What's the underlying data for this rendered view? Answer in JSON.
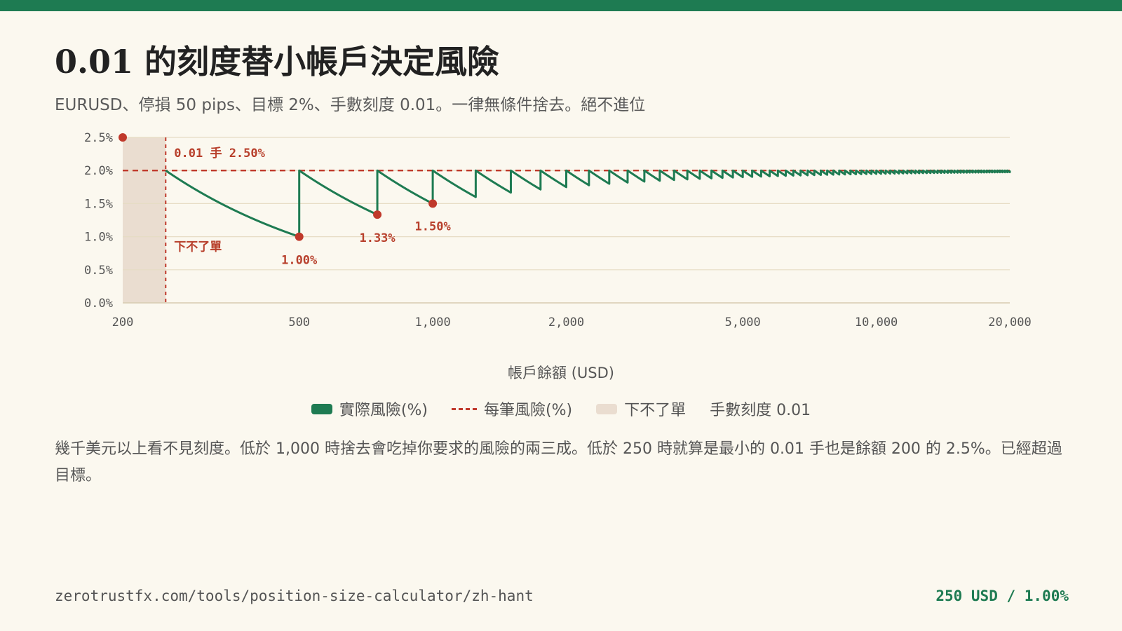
{
  "header": {
    "title": "0.01 的刻度替小帳戶決定風險",
    "subtitle": "EURUSD、停損 50 pips、目標 2%、手數刻度 0.01。一律無條件捨去。絕不進位"
  },
  "chart_data": {
    "type": "line",
    "xlabel": "帳戶餘額 (USD)",
    "x_scale": "log",
    "xlim": [
      200,
      20000
    ],
    "ylim": [
      0,
      2.5
    ],
    "x_ticks": [
      200,
      500,
      1000,
      2000,
      5000,
      10000,
      20000
    ],
    "x_tick_labels": [
      "200",
      "500",
      "1,000",
      "2,000",
      "5,000",
      "10,000",
      "20,000"
    ],
    "y_ticks": [
      0,
      0.5,
      1.0,
      1.5,
      2.0,
      2.5
    ],
    "y_tick_labels": [
      "0.0%",
      "0.5%",
      "1.0%",
      "1.5%",
      "2.0%",
      "2.5%"
    ],
    "grid": true,
    "legend_position": "bottom-center",
    "series": [
      {
        "name": "實際風險(%)",
        "color": "#1e7b52",
        "rule": "floor(balance * 2% / 500 USD per lot, step 0.01) * 500 / balance * 100",
        "min_balance": 250,
        "max_balance": 20000
      },
      {
        "name": "每筆風險(%)",
        "color": "#c0392b",
        "style": "dashed",
        "value": 2.0
      }
    ],
    "shaded_region": {
      "name": "下不了單",
      "from": 200,
      "to": 250,
      "color": "#eaddd0"
    },
    "vertical_marker": {
      "x": 250,
      "label_top": "0.01 手 2.50%",
      "label_bottom": "下不了單"
    },
    "points": [
      {
        "x": 200,
        "y": 2.5,
        "label": ""
      },
      {
        "x": 500,
        "y": 1.0,
        "label": "1.00%"
      },
      {
        "x": 750,
        "y": 1.333,
        "label": "1.33%"
      },
      {
        "x": 1000,
        "y": 1.5,
        "label": "1.50%"
      }
    ],
    "extra_legend": "手數刻度 0.01"
  },
  "legend": {
    "actual": "實際風險(%)",
    "target": "每筆風險(%)",
    "blocked": "下不了單",
    "step": "手數刻度 0.01"
  },
  "note": "幾千美元以上看不見刻度。低於 1,000 時捨去會吃掉你要求的風險的兩三成。低於 250 時就算是最小的 0.01 手也是餘額 200 的 2.5%。已經超過目標。",
  "footer": {
    "url": "zerotrustfx.com/tools/position-size-calculator/zh-hant",
    "stat": "250 USD / 1.00%"
  },
  "colors": {
    "accent": "#1e7b52",
    "danger": "#c0392b",
    "shade": "#eaddd0",
    "background": "#fbf8ef"
  }
}
